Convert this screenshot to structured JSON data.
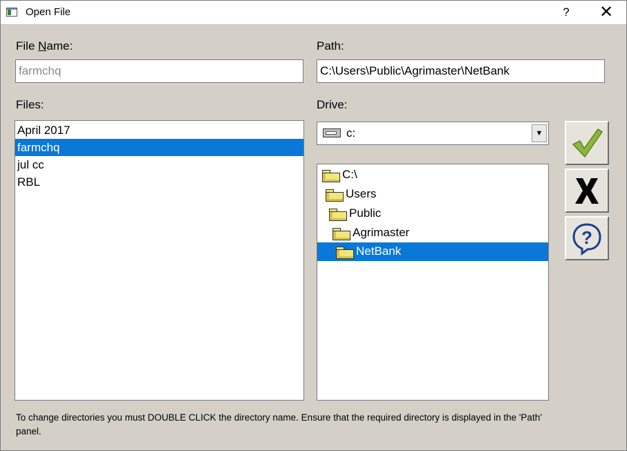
{
  "window": {
    "title": "Open File",
    "help_label": "?",
    "close_label": "✕"
  },
  "file_name": {
    "label_prefix": "File ",
    "label_underline": "N",
    "label_suffix": "ame:",
    "value": "farmchq"
  },
  "path": {
    "label": "Path:",
    "value": "C:\\Users\\Public\\Agrimaster\\NetBank"
  },
  "files": {
    "label": "Files:",
    "items": [
      "April 2017",
      "farmchq",
      "jul cc",
      "RBL"
    ],
    "selected_index": 1
  },
  "drive": {
    "label": "Drive:",
    "value": "c:",
    "icon": "drive-icon"
  },
  "directories": {
    "items": [
      "C:\\",
      "Users",
      "Public",
      "Agrimaster",
      "NetBank"
    ],
    "selected_index": 4
  },
  "buttons": {
    "ok_icon": "checkmark-icon",
    "cancel_icon": "x-icon",
    "help_icon": "help-question-icon"
  },
  "colors": {
    "selection": "#0a78d7",
    "checkmark": "#8ab83c",
    "help": "#1d3c8f"
  },
  "footer": {
    "text": "To change directories you must DOUBLE CLICK the directory name. Ensure that the required directory is displayed in the 'Path' panel."
  }
}
